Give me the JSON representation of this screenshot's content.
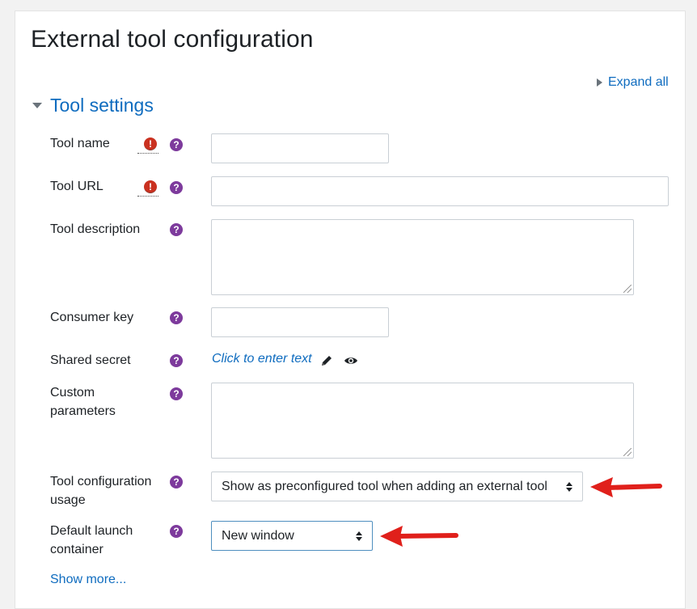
{
  "page": {
    "title": "External tool configuration"
  },
  "actions": {
    "expand_all": "Expand all",
    "show_more": "Show more..."
  },
  "section": {
    "title": "Tool settings"
  },
  "fields": {
    "tool_name": {
      "label": "Tool name",
      "value": ""
    },
    "tool_url": {
      "label": "Tool URL",
      "value": ""
    },
    "tool_description": {
      "label": "Tool description",
      "value": ""
    },
    "consumer_key": {
      "label": "Consumer key",
      "value": ""
    },
    "shared_secret": {
      "label": "Shared secret",
      "placeholder": "Click to enter text"
    },
    "custom_parameters": {
      "label_line1": "Custom",
      "label_line2": "parameters",
      "value": ""
    },
    "tool_configuration_usage": {
      "label_line1": "Tool configuration",
      "label_line2": "usage",
      "selected": "Show as preconfigured tool when adding an external tool"
    },
    "default_launch_container": {
      "label_line1": "Default launch",
      "label_line2": "container",
      "selected": "New window"
    }
  },
  "icons": {
    "required": "!",
    "help": "?"
  },
  "colors": {
    "link": "#0f6cbf",
    "required": "#ca3120",
    "help": "#7d3a9c",
    "annotation_arrow": "#e0201b"
  }
}
